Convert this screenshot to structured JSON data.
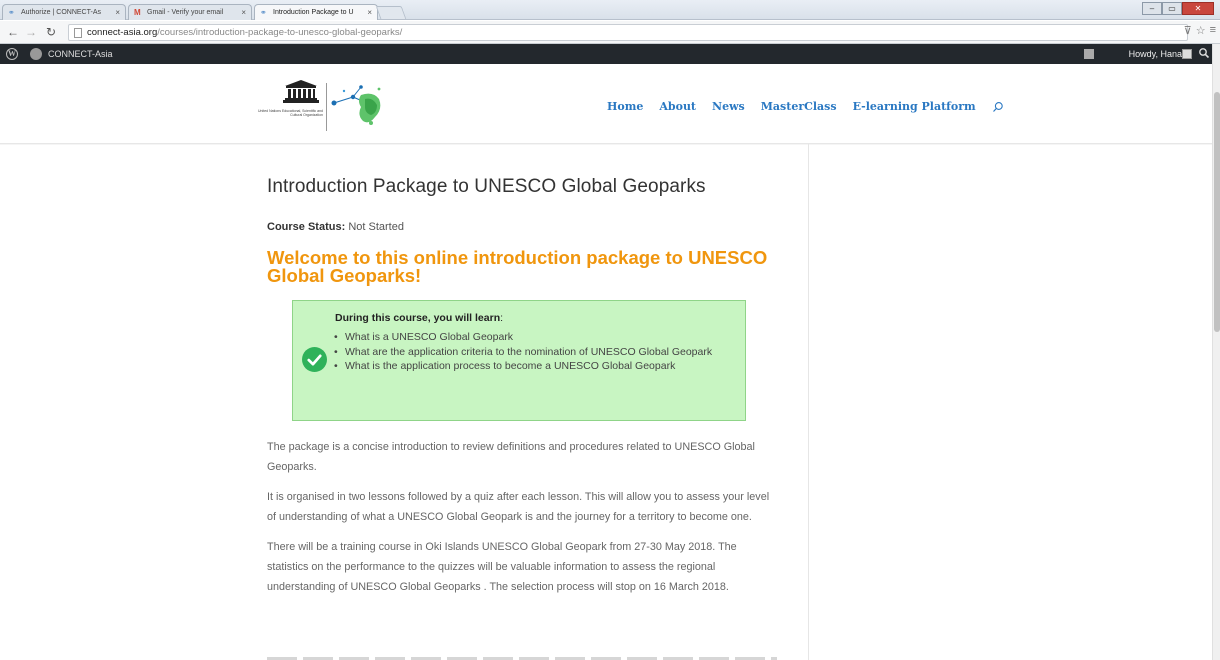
{
  "browser": {
    "tabs": [
      {
        "label": "Authorize | CONNECT-As",
        "icon": "connect-favicon"
      },
      {
        "label": "Gmail - Verify your email",
        "icon": "gmail-favicon"
      },
      {
        "label": "Introduction Package to U",
        "icon": "connect-favicon"
      }
    ],
    "tab_close": "×",
    "url_host": "connect-asia.org",
    "url_path": "/courses/introduction-package-to-unesco-global-geoparks/"
  },
  "admin_bar": {
    "site_name": "CONNECT-Asia",
    "howdy": "Howdy, Hana"
  },
  "site": {
    "nav": {
      "home": "Home",
      "about": "About",
      "news": "News",
      "masterclass": "MasterClass",
      "elearning": "E-learning Platform"
    },
    "nav_color": "#2a78c2",
    "logo_text": "United Nations Educational, Scientific and Cultural Organization"
  },
  "course": {
    "title": "Introduction Package to UNESCO Global Geoparks",
    "status_label": "Course Status:",
    "status_value": "Not Started",
    "welcome_heading": "Welcome to this online introduction package to UNESCO Global Geoparks!",
    "welcome_color": "#f0960e",
    "learn_heading": "During this course, you will learn",
    "learn_heading_colon": ":",
    "learn_items": [
      "What is a UNESCO Global Geopark",
      "What are the application criteria to the nomination of UNESCO Global Geopark",
      "What is the application process to become a UNESCO Global Geopark"
    ],
    "learn_box_color": "#c8f5c2",
    "paragraphs": [
      "The package is a concise introduction to review definitions and procedures related to UNESCO Global Geoparks.",
      "It  is organised  in two lessons followed by a quiz after each lesson. This will allow you to assess your level of understanding of what a UNESCO Global Geopark is and the journey for a territory to become one.",
      "There will be a training course in Oki  Islands UNESCO Global Geopark from 27-30 May 2018. The statistics on the performance to the quizzes will be valuable information to assess the regional understanding of UNESCO Global Geoparks .   The selection process will stop on 16 March 2018."
    ]
  }
}
